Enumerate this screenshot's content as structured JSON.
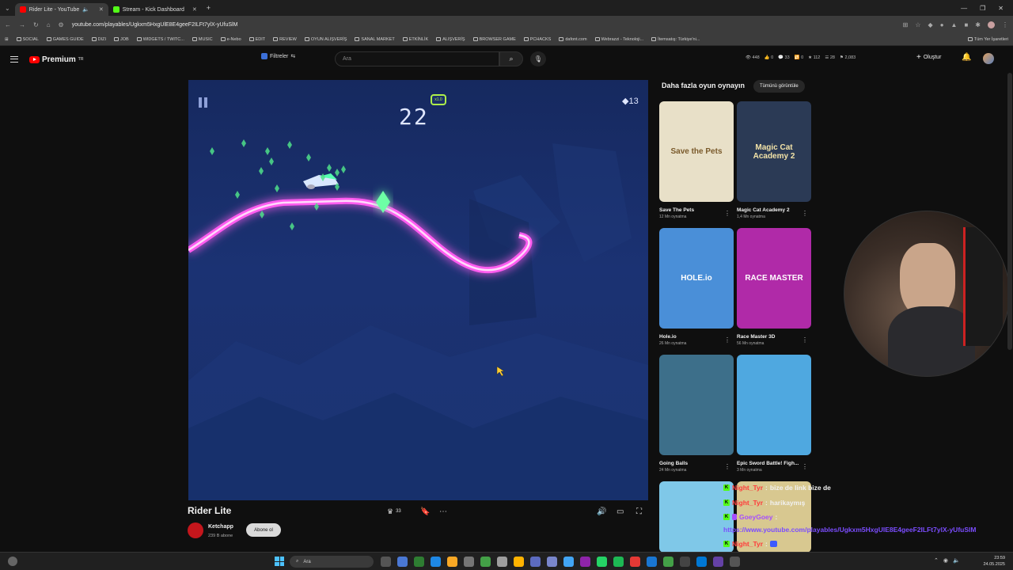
{
  "browser": {
    "tabs": [
      {
        "label": "Rider Lite - YouTube",
        "active": true
      },
      {
        "label": "Stream - Kick Dashboard",
        "active": false
      }
    ],
    "url": "youtube.com/playables/Ugkxm5HxgUlE8E4geeF2ILFt7ylX-yUfuSlM",
    "bookmarks": [
      "SOCIAL",
      "GAMES GUIDE",
      "DIZI",
      "JOB",
      "WIDGETS / TWITC...",
      "MUSIC",
      "e-Nebo",
      "EDIT",
      "REVIEW",
      "OYUN ALIŞVERİŞ",
      "SANAL MARKET",
      "ETKİNLİK",
      "ALIŞVERİŞ",
      "BROWSER GAME",
      "PCHACKS",
      "dafont.com",
      "Webrazzi - Teknoloji...",
      "İtemsatış: Türkiye'ni...",
      "Tüm Yer İşaretleri"
    ]
  },
  "yt_header": {
    "logo": "Premium",
    "logo_suffix": "TR",
    "filters": "Filtreler",
    "search_placeholder": "Ara",
    "stats": [
      "448",
      "0",
      "33",
      "0",
      "112",
      "28",
      "2,083"
    ],
    "create": "Oluştur"
  },
  "game": {
    "score": "22",
    "multiplier": "x1.0",
    "gems": "13"
  },
  "video": {
    "title": "Rider Lite",
    "likes": "33",
    "channel": "Ketchapp",
    "subscribers": "239 B abone",
    "subscribe": "Abone ol"
  },
  "sidebar": {
    "title": "Daha fazla oyun oynayın",
    "see_all": "Tümünü görüntüle",
    "games": [
      {
        "name": "Save The Pets",
        "plays": "12 Mn oynatma",
        "thumb_text": "Save the Pets",
        "bg": "#e8e0c8",
        "fg": "#7a5a2b"
      },
      {
        "name": "Magic Cat Academy 2",
        "plays": "1,4 Mn oynatma",
        "thumb_text": "Magic Cat Academy 2",
        "bg": "#2b3a55",
        "fg": "#f3e3a8"
      },
      {
        "name": "Hole.io",
        "plays": "26 Mn oynatma",
        "thumb_text": "HOLE.io",
        "bg": "#4a8fd8",
        "fg": "#ffffff"
      },
      {
        "name": "Race Master 3D",
        "plays": "56 Mn oynatma",
        "thumb_text": "RACE MASTER",
        "bg": "#b02aa8",
        "fg": "#ffffff"
      },
      {
        "name": "Going Balls",
        "plays": "24 Mn oynatma",
        "thumb_text": "",
        "bg": "#3d6f8a",
        "fg": "#ffffff"
      },
      {
        "name": "Epic Sword Battle! Figh...",
        "plays": "3 Mn oynatma",
        "thumb_text": "",
        "bg": "#4fa8e0",
        "fg": "#ffffff"
      }
    ]
  },
  "chat": [
    {
      "user": "Night_Tyr",
      "msg": "bize de link bize de"
    },
    {
      "user": "Night_Tyr",
      "msg": "harikaymış"
    },
    {
      "user": "GoeyGoey",
      "msg": ""
    },
    {
      "link": "https://www.youtube.com/playables/Ugkxm5HxgUlE8E4geeF2ILFt7ylX-yUfuSlM"
    },
    {
      "user": "Night_Tyr",
      "msg": ""
    }
  ],
  "taskbar": {
    "search": "Ara",
    "time": "23:59",
    "date": "24.05.2025"
  },
  "colors": {
    "youtube_red": "#ff0000",
    "kick_green": "#53fc18",
    "neon_track": "#ff5cf0"
  }
}
